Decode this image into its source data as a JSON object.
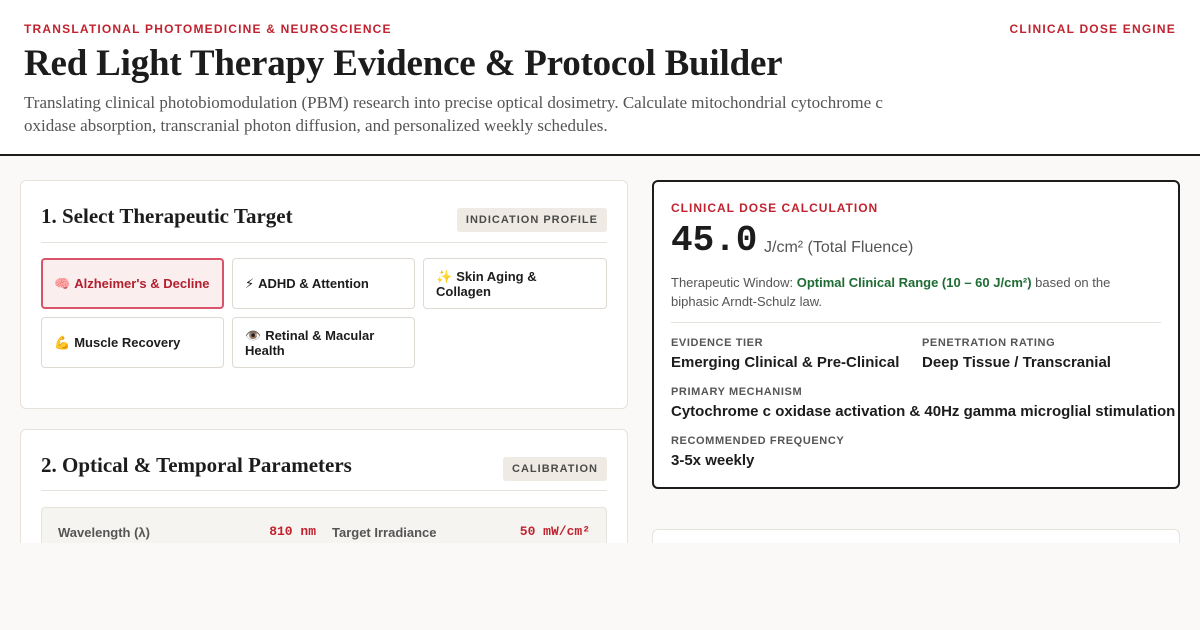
{
  "header": {
    "eyebrow_left": "TRANSLATIONAL PHOTOMEDICINE & NEUROSCIENCE",
    "eyebrow_right": "CLINICAL DOSE ENGINE",
    "title": "Red Light Therapy Evidence & Protocol Builder",
    "subtitle": "Translating clinical photobiomodulation (PBM) research into precise optical dosimetry. Calculate mitochondrial cytochrome c oxidase absorption, transcranial photon diffusion, and personalized weekly schedules."
  },
  "target_section": {
    "title": "1. Select Therapeutic Target",
    "tag": "INDICATION PROFILE",
    "options": [
      {
        "icon": "brain-icon",
        "emoji": "🧠",
        "label": "Alzheimer's & Decline",
        "selected": true
      },
      {
        "icon": "lightning-icon",
        "emoji": "⚡",
        "label": "ADHD & Attention",
        "selected": false
      },
      {
        "icon": "sparkles-icon",
        "emoji": "✨",
        "label": "Skin Aging & Collagen",
        "selected": false
      },
      {
        "icon": "flexed-biceps-icon",
        "emoji": "💪",
        "label": "Muscle Recovery",
        "selected": false
      },
      {
        "icon": "eye-icon",
        "emoji": "👁️",
        "label": "Retinal & Macular Health",
        "selected": false
      }
    ]
  },
  "parameters_section": {
    "title": "2. Optical & Temporal Parameters",
    "tag": "CALIBRATION",
    "wavelength": {
      "label": "Wavelength (λ)",
      "value": "810 nm"
    },
    "irradiance": {
      "label": "Target Irradiance",
      "value": "50 mW/cm²"
    }
  },
  "dose": {
    "eyebrow": "CLINICAL DOSE CALCULATION",
    "value": "45.0",
    "unit": "J/cm² (Total Fluence)",
    "window_prefix": "Therapeutic Window: ",
    "window_highlight": "Optimal Clinical Range (10 – 60 J/cm²)",
    "window_suffix": " based on the biphasic Arndt-Schulz law.",
    "evidence_label": "EVIDENCE TIER",
    "evidence_value": "Emerging Clinical & Pre-Clinical",
    "penetration_label": "PENETRATION RATING",
    "penetration_value": "Deep Tissue / Transcranial",
    "mechanism_label": "PRIMARY MECHANISM",
    "mechanism_value": "Cytochrome c oxidase activation & 40Hz gamma microglial stimulation",
    "frequency_label": "RECOMMENDED FREQUENCY",
    "frequency_value": "3-5x weekly"
  },
  "colors": {
    "accent_red": "#c0232f",
    "selected_border": "#d9546a",
    "selected_bg": "#fbeeef",
    "success_green": "#1e6b34",
    "ink": "#1c1c1c"
  }
}
